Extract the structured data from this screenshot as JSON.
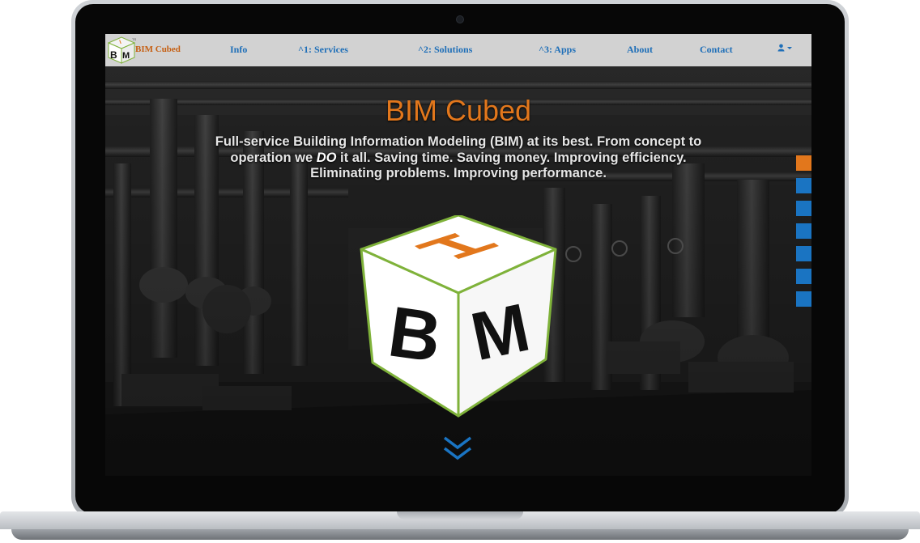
{
  "nav": {
    "brand": "BIM Cubed",
    "links": [
      {
        "label": "Info"
      },
      {
        "label": "^1: Services"
      },
      {
        "label": "^2: Solutions"
      },
      {
        "label": "^3: Apps"
      },
      {
        "label": "About"
      },
      {
        "label": "Contact"
      }
    ],
    "user_icon": "user-icon",
    "caret_icon": "caret-down-icon"
  },
  "hero": {
    "title": "BIM Cubed",
    "tagline_start": "Full-service Building Information Modeling (BIM) at its best. From concept to operation we ",
    "tagline_em": "DO",
    "tagline_end": " it all. Saving time. Saving money. Improving efficiency. Eliminating problems. Improving performance.",
    "logo_letters": {
      "top": "I",
      "left": "B",
      "right": "M"
    }
  },
  "side_nav": {
    "count": 7,
    "active_index": 0
  },
  "scroll_icon": "double-chevron-down-icon",
  "colors": {
    "accent": "#e2771c",
    "link": "#1f6fb8",
    "dot": "#1a74c2",
    "navbar": "#d2d2d2",
    "cube_edge": "#7fb23a"
  }
}
